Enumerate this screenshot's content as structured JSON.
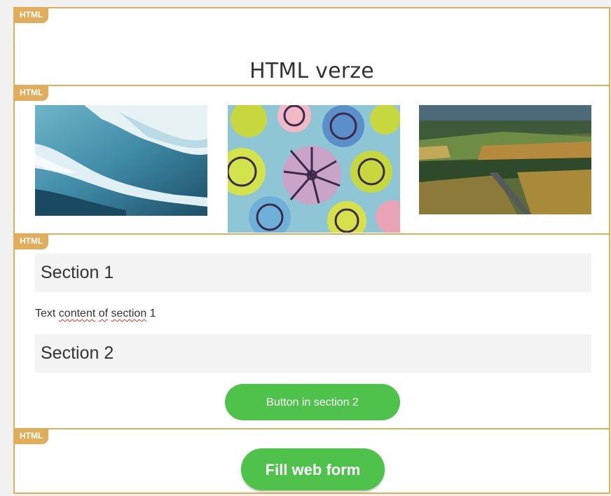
{
  "colors": {
    "frame": "#e0ad5a",
    "button": "#4ec24a",
    "section_bg": "#f3f3f3"
  },
  "tags": [
    "HTML",
    "HTML",
    "HTML",
    "HTML"
  ],
  "header": {
    "title": "HTML verze"
  },
  "gallery": {
    "images": [
      {
        "name": "glacier-ice-image"
      },
      {
        "name": "flower-pattern-image"
      },
      {
        "name": "aerial-fields-image"
      }
    ]
  },
  "sections": {
    "section1": {
      "title": "Section 1",
      "text_parts": [
        "Text ",
        "content",
        " ",
        "of",
        " ",
        "section",
        " 1"
      ]
    },
    "section2": {
      "title": "Section 2",
      "button_label": "Button in section 2"
    }
  },
  "form": {
    "button_label": "Fill web form"
  }
}
